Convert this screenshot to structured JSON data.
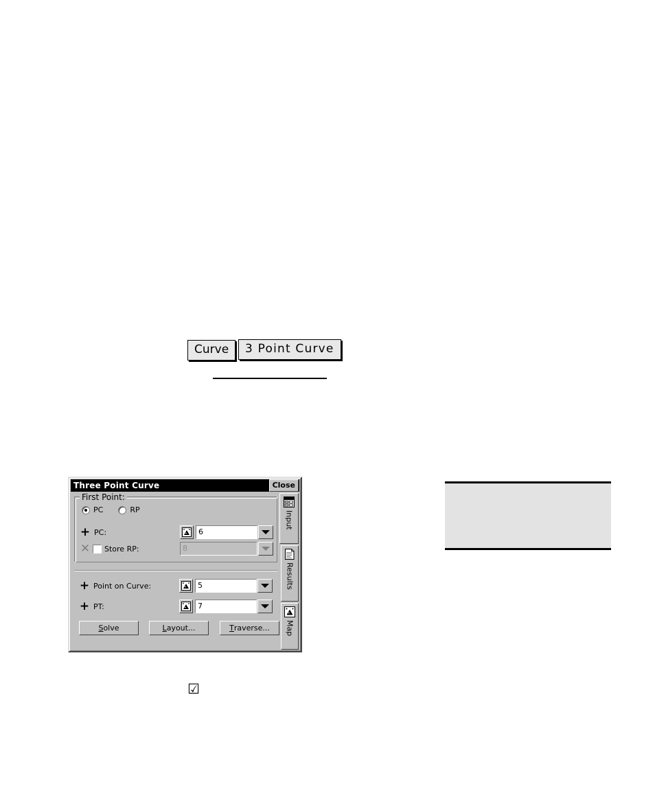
{
  "inline_commands": [
    {
      "label": "Curve",
      "name": "curve-command-box"
    },
    {
      "label": "3 Point Curve",
      "name": "three-point-curve-command-box"
    }
  ],
  "note_box": {
    "text": ""
  },
  "checkbox_glyph": {
    "char": "☑"
  },
  "dialog": {
    "title": "Three Point Curve",
    "close_label": "Close",
    "group": {
      "legend": "First Point:",
      "radios": [
        {
          "label": "PC",
          "selected": true
        },
        {
          "label": "RP",
          "selected": false
        }
      ],
      "rows": [
        {
          "icon": "plus-icon",
          "icon_char": "+",
          "label": "PC:",
          "value": "6",
          "disabled": false,
          "has_checkbox": false,
          "checked": false
        },
        {
          "icon": "x-icon",
          "icon_char": "✕",
          "label": "Store RP:",
          "value": "8",
          "disabled": true,
          "has_checkbox": true,
          "checked": false
        }
      ]
    },
    "rows": [
      {
        "icon": "plus-icon",
        "icon_char": "+",
        "label": "Point on Curve:",
        "value": "5",
        "disabled": false
      },
      {
        "icon": "plus-icon",
        "icon_char": "+",
        "label": "PT:",
        "value": "7",
        "disabled": false
      }
    ],
    "buttons": [
      {
        "name": "solve-button",
        "accel": "S",
        "rest": "olve"
      },
      {
        "name": "layout-button",
        "accel": "L",
        "rest": "ayout..."
      },
      {
        "name": "traverse-button",
        "accel": "T",
        "rest": "raverse..."
      }
    ],
    "tabs": [
      {
        "label": "Input",
        "icon": "form-icon",
        "active": true
      },
      {
        "label": "Results",
        "icon": "document-icon",
        "active": false
      },
      {
        "label": "Map",
        "icon": "map-pick-icon",
        "active": false
      }
    ],
    "pick_icon_name": "map-pick-icon"
  },
  "colors": {
    "dialog_face": "#c0c0c0",
    "titlebar": "#000000",
    "titlebar_text": "#ffffff",
    "input_bg": "#ffffff",
    "disabled_text": "#909090",
    "note_bg": "#e3e3e3"
  }
}
